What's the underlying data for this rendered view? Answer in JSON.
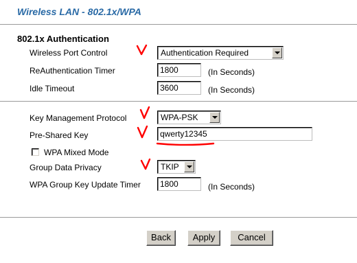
{
  "page": {
    "title": "Wireless LAN - 802.1x/WPA"
  },
  "auth": {
    "heading": "802.1x Authentication",
    "port_control": {
      "label": "Wireless Port Control",
      "value": "Authentication Required"
    },
    "reauth": {
      "label": "ReAuthentication Timer",
      "value": "1800",
      "unit": "(In Seconds)"
    },
    "idle": {
      "label": "Idle Timeout",
      "value": "3600",
      "unit": "(In Seconds)"
    }
  },
  "wpa": {
    "key_mgmt": {
      "label": "Key Management Protocol",
      "value": "WPA-PSK"
    },
    "psk": {
      "label": "Pre-Shared Key",
      "value": "qwerty12345"
    },
    "mixed_mode": {
      "label": "WPA Mixed Mode",
      "checked": false
    },
    "privacy": {
      "label": "Group Data Privacy",
      "value": "TKIP"
    },
    "group_key": {
      "label": "WPA Group Key Update Timer",
      "value": "1800",
      "unit": "(In Seconds)"
    }
  },
  "buttons": {
    "back": "Back",
    "apply": "Apply",
    "cancel": "Cancel"
  },
  "annotations": {
    "color": "#ff0000"
  }
}
